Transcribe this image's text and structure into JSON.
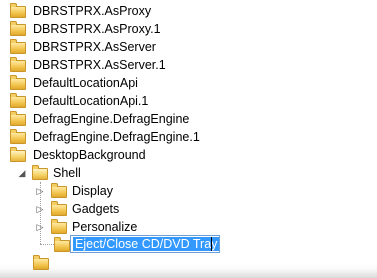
{
  "tree": {
    "top_items": [
      "DBRSTPRX.AsProxy",
      "DBRSTPRX.AsProxy.1",
      "DBRSTPRX.AsServer",
      "DBRSTPRX.AsServer.1",
      "DefaultLocationApi",
      "DefaultLocationApi.1",
      "DefragEngine.DefragEngine",
      "DefragEngine.DefragEngine.1",
      "DesktopBackground"
    ],
    "shell": "Shell",
    "children": [
      "Display",
      "Gadgets",
      "Personalize"
    ],
    "rename_value": "Eject/Close CD/DVD Tray"
  }
}
